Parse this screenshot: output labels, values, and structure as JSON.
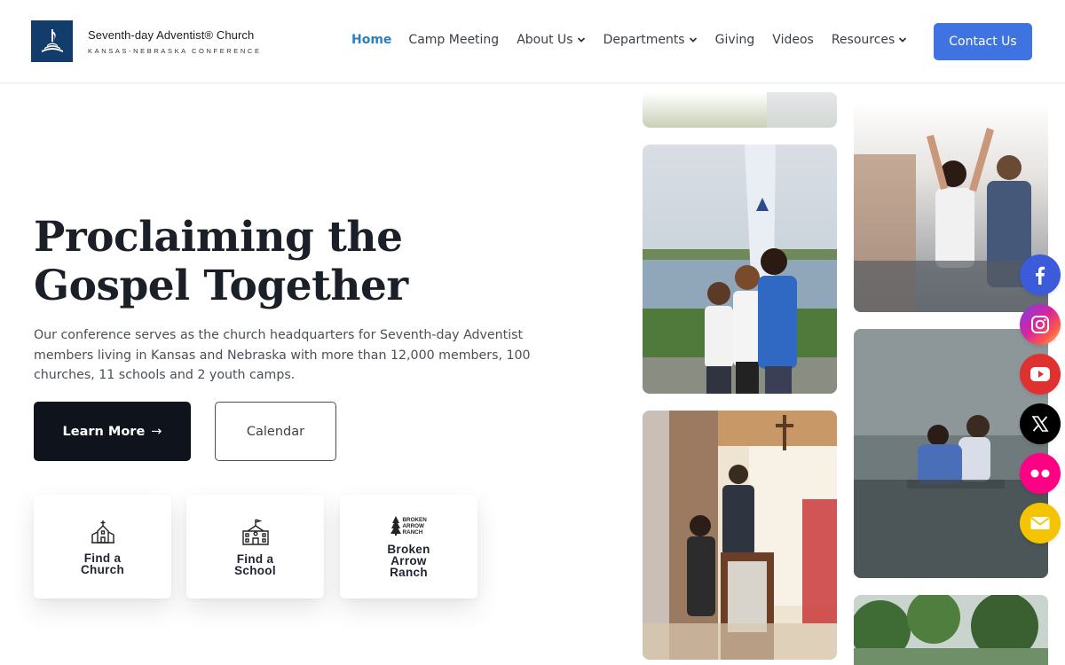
{
  "header": {
    "logo_title": "Seventh-day Adventist® Church",
    "logo_subtitle": "KANSAS-NEBRASKA CONFERENCE",
    "nav": [
      {
        "label": "Home",
        "active": true,
        "dropdown": false
      },
      {
        "label": "Camp Meeting",
        "active": false,
        "dropdown": false
      },
      {
        "label": "About Us",
        "active": false,
        "dropdown": true
      },
      {
        "label": "Departments",
        "active": false,
        "dropdown": true
      },
      {
        "label": "Giving",
        "active": false,
        "dropdown": false
      },
      {
        "label": "Videos",
        "active": false,
        "dropdown": false
      },
      {
        "label": "Resources",
        "active": false,
        "dropdown": true
      }
    ],
    "contact_label": "Contact Us"
  },
  "hero": {
    "title_line1": "Proclaiming the",
    "title_line2": "Gospel Together",
    "description": "Our conference serves as the church headquarters for Seventh-day Adventist members living in Kansas and Nebraska with more than 12,000 members, 100 churches, 11 schools and 2 youth camps.",
    "learn_more_label": "Learn More",
    "calendar_label": "Calendar"
  },
  "quick_links": [
    {
      "line1": "Find a",
      "line2": "Church",
      "icon": "church-icon"
    },
    {
      "line1": "Find a",
      "line2": "School",
      "icon": "school-icon"
    },
    {
      "line1": "Broken",
      "line2": "Arrow",
      "line3": "Ranch",
      "icon": "broken-arrow-ranch-logo",
      "logo_text": [
        "BROKEN",
        "ARROW",
        "RANCH"
      ]
    }
  ],
  "social": [
    {
      "name": "facebook",
      "color": "#3b5bdb"
    },
    {
      "name": "instagram",
      "color": "#c13584"
    },
    {
      "name": "youtube",
      "color": "#e03131"
    },
    {
      "name": "x",
      "color": "#000000"
    },
    {
      "name": "flickr",
      "color": "#ff0084"
    },
    {
      "name": "email",
      "color": "#f5c400"
    }
  ],
  "colors": {
    "accent": "#3f73e2",
    "nav_active": "#2b7fc4",
    "primary_button": "#0f141c",
    "logo_bg": "#123c6b"
  }
}
